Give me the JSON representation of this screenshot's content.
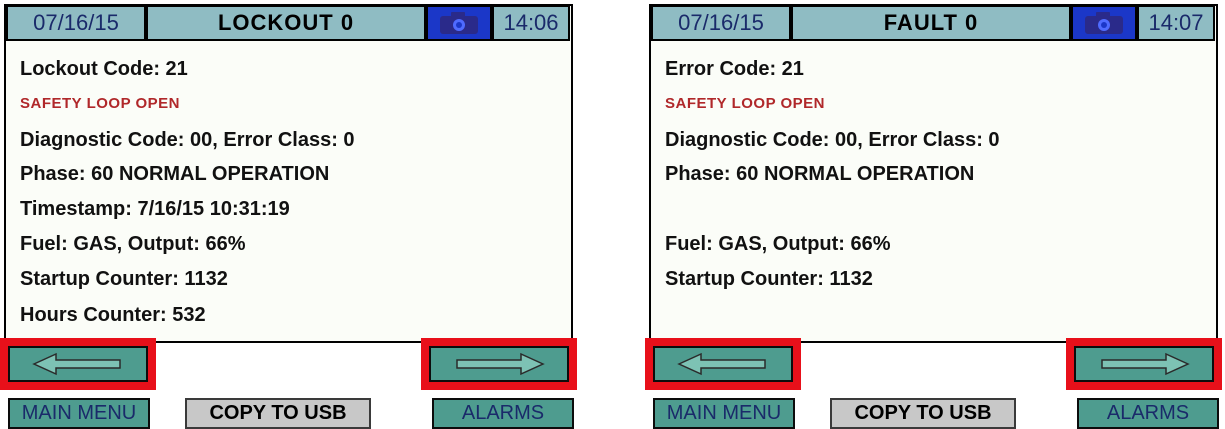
{
  "left_screen": {
    "date": "07/16/15",
    "title": "LOCKOUT 0",
    "camera_icon": "camera-icon",
    "time": "14:06",
    "lines": [
      "Lockout Code: 21",
      "SAFETY LOOP OPEN",
      "Diagnostic Code: 00, Error Class: 0",
      "Phase: 60 NORMAL OPERATION",
      "Timestamp: 7/16/15 10:31:19",
      "Fuel: GAS, Output: 66%",
      "Startup Counter: 1132",
      "Hours Counter: 532"
    ],
    "main_menu_label": "MAIN MENU",
    "copy_usb_label": "COPY TO USB",
    "alarms_label": "ALARMS"
  },
  "right_screen": {
    "date": "07/16/15",
    "title": "FAULT 0",
    "camera_icon": "camera-icon",
    "time": "14:07",
    "lines": [
      "Error Code: 21",
      "SAFETY LOOP OPEN",
      "Diagnostic Code: 00, Error Class: 0",
      "Phase: 60 NORMAL OPERATION",
      "Fuel: GAS, Output: 66%",
      "Startup Counter: 1132"
    ],
    "main_menu_label": "MAIN MENU",
    "copy_usb_label": "COPY TO USB",
    "alarms_label": "ALARMS"
  },
  "colors": {
    "header_bg": "#8fbcc3",
    "button_teal": "#4e9c8f",
    "highlight_red": "#e8101a",
    "alert_text": "#b0282a",
    "camera_blue": "#1b37c8"
  },
  "icons": {
    "prev": "left-arrow-icon",
    "next": "right-arrow-icon"
  }
}
